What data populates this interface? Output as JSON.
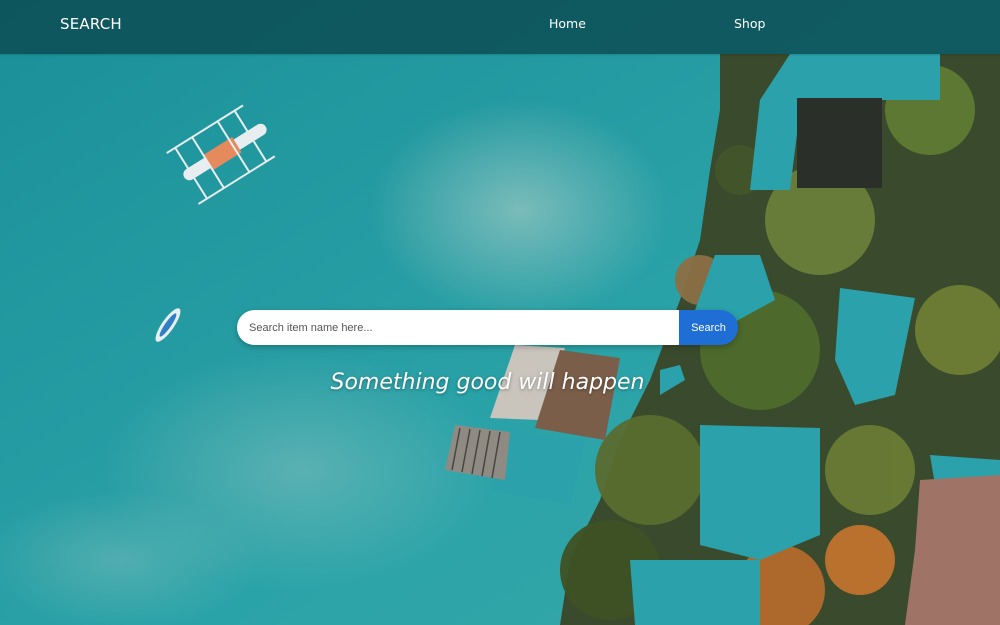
{
  "navbar": {
    "brand": "SEARCH",
    "links": [
      "Home",
      "Shop"
    ]
  },
  "search": {
    "placeholder": "Search item name here...",
    "value": "",
    "button_label": "Search"
  },
  "hero": {
    "tagline": "Something good will happen"
  },
  "colors": {
    "navbar_bg": "#0a464e",
    "button_bg": "#1e6ed6",
    "water": "#1a8e97"
  }
}
